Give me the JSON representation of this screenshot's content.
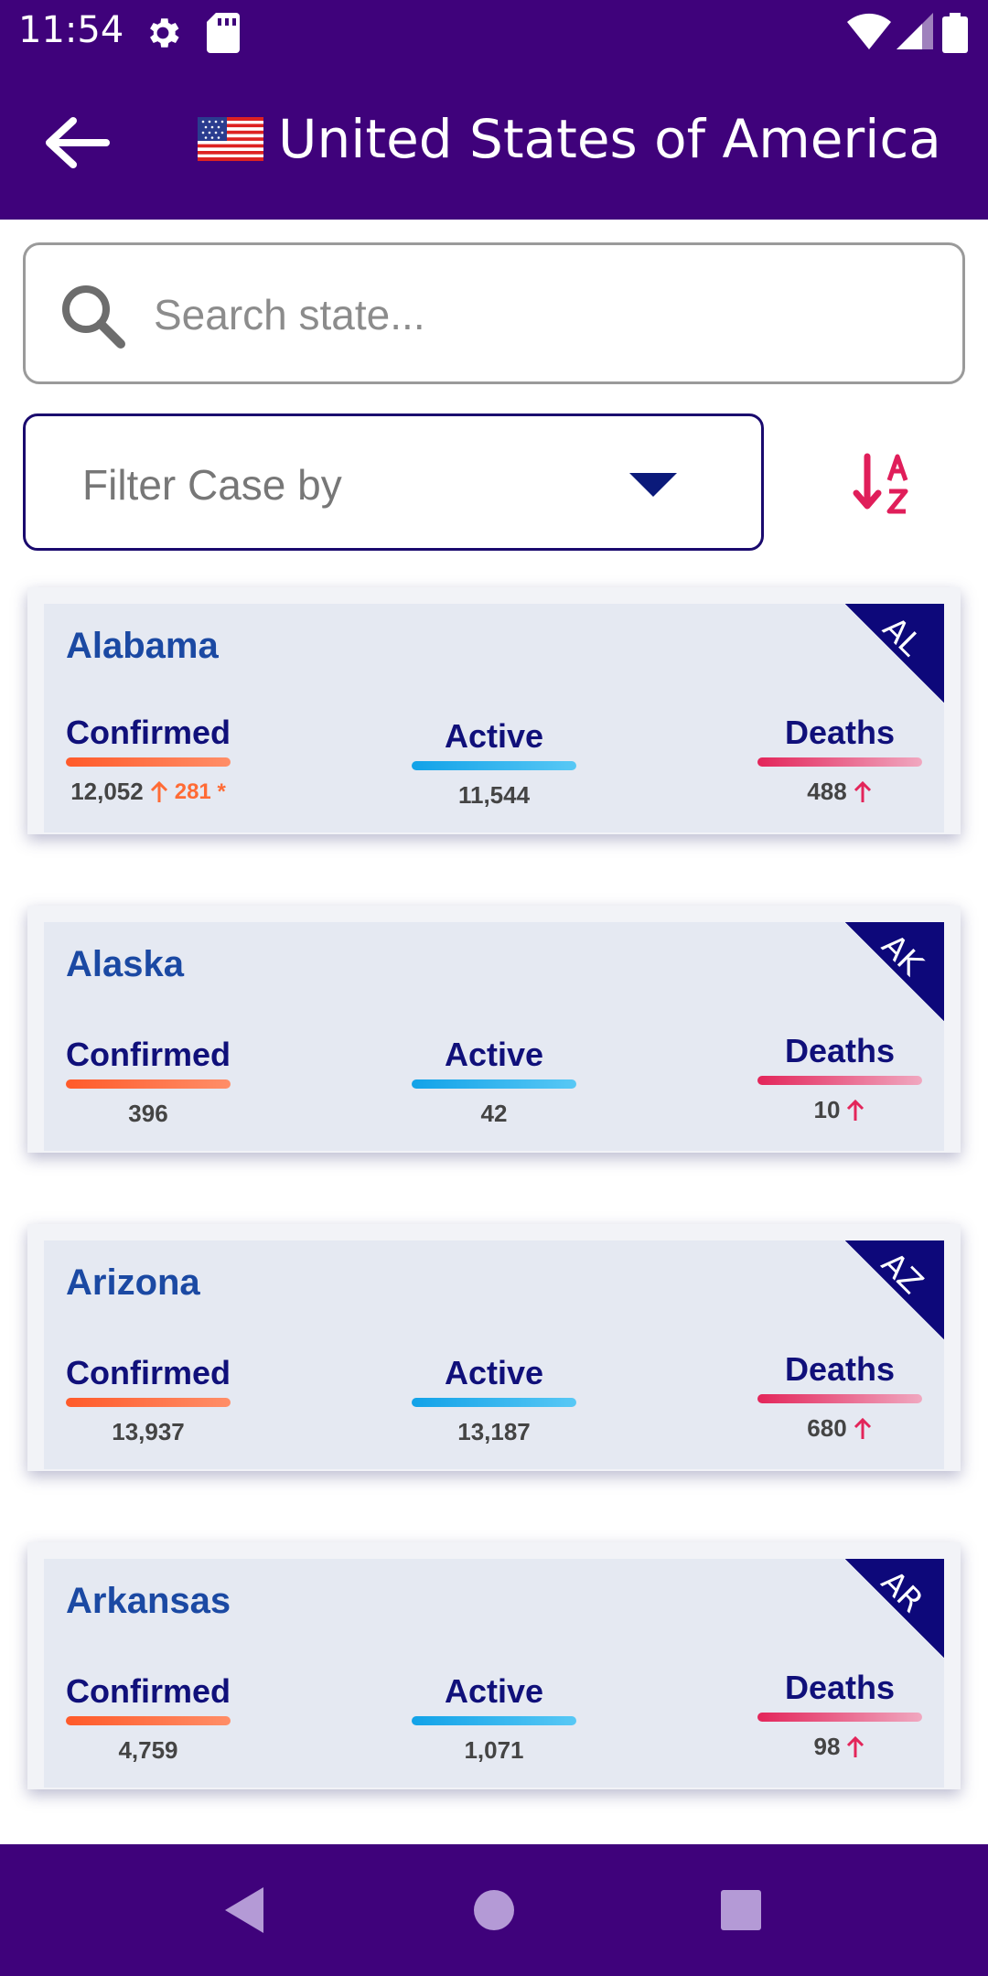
{
  "status_bar": {
    "time": "11:54"
  },
  "header": {
    "title": "United States of America"
  },
  "search": {
    "placeholder": "Search state..."
  },
  "filter": {
    "label": "Filter Case by"
  },
  "colors": {
    "primary": "#3f027b",
    "confirmed": "#ff5a2a",
    "active": "#12a2e8",
    "deaths": "#e3255a",
    "state_name": "#1b49a3"
  },
  "cards": [
    {
      "name": "Alabama",
      "code": "AL",
      "confirmed_label": "Confirmed",
      "confirmed": "12,052",
      "confirmed_delta": "281 *",
      "active_label": "Active",
      "active": "11,544",
      "deaths_label": "Deaths",
      "deaths": "488"
    },
    {
      "name": "Alaska",
      "code": "AK",
      "confirmed_label": "Confirmed",
      "confirmed": "396",
      "active_label": "Active",
      "active": "42",
      "deaths_label": "Deaths",
      "deaths": "10"
    },
    {
      "name": "Arizona",
      "code": "AZ",
      "confirmed_label": "Confirmed",
      "confirmed": "13,937",
      "active_label": "Active",
      "active": "13,187",
      "deaths_label": "Deaths",
      "deaths": "680"
    },
    {
      "name": "Arkansas",
      "code": "AR",
      "confirmed_label": "Confirmed",
      "confirmed": "4,759",
      "active_label": "Active",
      "active": "1,071",
      "deaths_label": "Deaths",
      "deaths": "98"
    }
  ],
  "icons": {
    "status": [
      "gear-icon",
      "sd-card-icon",
      "wifi-icon",
      "signal-icon",
      "battery-icon"
    ],
    "header": [
      "back-arrow-icon",
      "us-flag-icon"
    ],
    "search": "search-icon",
    "filter": "dropdown-caret-icon",
    "sort": "sort-az-icon",
    "nav": [
      "nav-back-icon",
      "nav-home-icon",
      "nav-recents-icon"
    ]
  }
}
